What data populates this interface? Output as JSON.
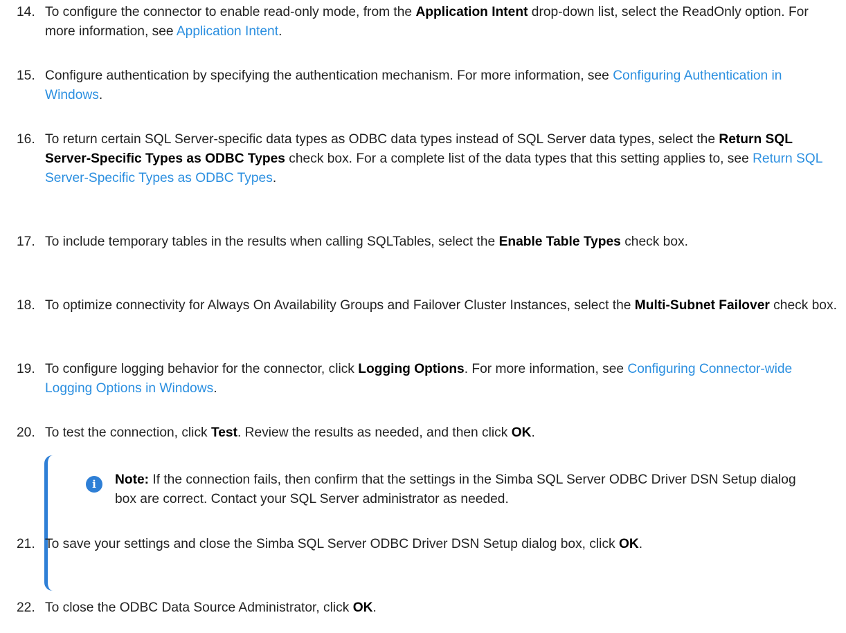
{
  "steps": [
    {
      "num": "14.",
      "parts": [
        {
          "t": "text",
          "v": "To configure the connector to enable read-only mode, from the "
        },
        {
          "t": "bold",
          "v": "Application Intent"
        },
        {
          "t": "text",
          "v": " drop-down list, select the ReadOnly option. For more information, see "
        },
        {
          "t": "link",
          "v": "Application Intent"
        },
        {
          "t": "text",
          "v": "."
        }
      ]
    },
    {
      "num": "15.",
      "parts": [
        {
          "t": "text",
          "v": "Configure authentication by specifying the authentication mechanism. For more information, see "
        },
        {
          "t": "link",
          "v": "Configuring Authentication in Windows"
        },
        {
          "t": "text",
          "v": "."
        }
      ]
    },
    {
      "num": "16.",
      "parts": [
        {
          "t": "text",
          "v": "To return certain SQL Server-specific data types as ODBC data types instead of SQL Server data types, select the "
        },
        {
          "t": "bold",
          "v": "Return SQL Server-Specific Types as ODBC Types"
        },
        {
          "t": "text",
          "v": " check box. For a complete list of the data types that this setting applies to, see "
        },
        {
          "t": "link",
          "v": "Return SQL Server-Specific Types as ODBC Types"
        },
        {
          "t": "text",
          "v": "."
        }
      ]
    },
    {
      "num": "17.",
      "parts": [
        {
          "t": "text",
          "v": "To include temporary tables in the results when calling SQLTables, select the "
        },
        {
          "t": "bold",
          "v": "Enable Table Types"
        },
        {
          "t": "text",
          "v": " check box."
        }
      ]
    },
    {
      "num": "18.",
      "parts": [
        {
          "t": "text",
          "v": "To optimize connectivity for Always On Availability Groups and Failover Cluster Instances, select the "
        },
        {
          "t": "bold",
          "v": "Multi-Subnet Failover"
        },
        {
          "t": "text",
          "v": " check box."
        }
      ]
    },
    {
      "num": "19.",
      "parts": [
        {
          "t": "text",
          "v": "To configure logging behavior for the connector, click "
        },
        {
          "t": "bold",
          "v": "Logging Options"
        },
        {
          "t": "text",
          "v": ". For more information, see "
        },
        {
          "t": "link",
          "v": "Configuring Connector-wide Logging Options in Windows"
        },
        {
          "t": "text",
          "v": "."
        }
      ]
    },
    {
      "num": "20.",
      "parts": [
        {
          "t": "text",
          "v": "To test the connection, click "
        },
        {
          "t": "bold",
          "v": "Test"
        },
        {
          "t": "text",
          "v": ". Review the results as needed, and then click "
        },
        {
          "t": "bold",
          "v": "OK"
        },
        {
          "t": "text",
          "v": "."
        }
      ]
    },
    {
      "num": "21.",
      "parts": [
        {
          "t": "text",
          "v": "To save your settings and close the Simba SQL Server ODBC Driver DSN Setup dialog box, click "
        },
        {
          "t": "bold",
          "v": "OK"
        },
        {
          "t": "text",
          "v": "."
        }
      ]
    },
    {
      "num": "22.",
      "parts": [
        {
          "t": "text",
          "v": "To close the ODBC Data Source Administrator, click "
        },
        {
          "t": "bold",
          "v": "OK"
        },
        {
          "t": "text",
          "v": "."
        }
      ]
    }
  ],
  "note": {
    "icon": "info-icon",
    "icon_glyph": "i",
    "label": "Note:",
    "text": " If the connection fails, then confirm that the settings in the Simba SQL Server ODBC Driver DSN Setup dialog box are correct. Contact your SQL Server administrator as needed."
  },
  "colors": {
    "link": "#2b8fe0",
    "note_accent": "#2e7fd6",
    "text": "#222222"
  }
}
